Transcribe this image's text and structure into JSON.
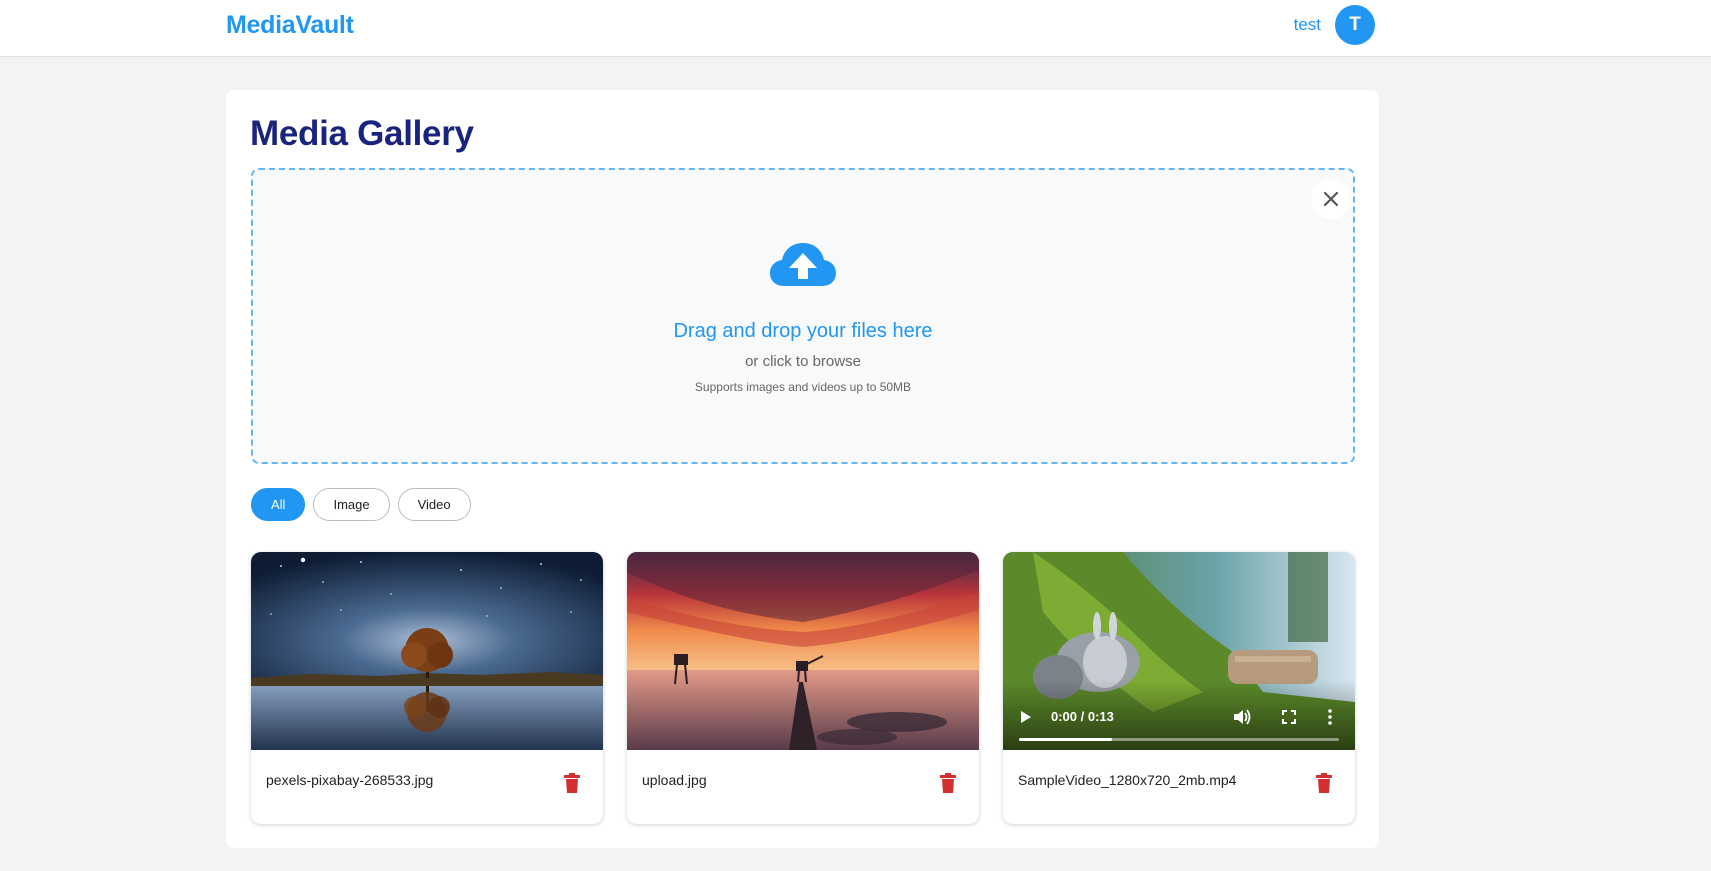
{
  "header": {
    "brand": "MediaVault",
    "username": "test",
    "avatar_initial": "T"
  },
  "main": {
    "title": "Media Gallery"
  },
  "dropzone": {
    "title": "Drag and drop your files here",
    "subtitle": "or click to browse",
    "note": "Supports images and videos up to 50MB",
    "icon": "cloud-upload-icon",
    "close_icon": "close-icon"
  },
  "filters": {
    "all": "All",
    "image": "Image",
    "video": "Video",
    "active": "All"
  },
  "media": [
    {
      "name": "pexels-pixabay-268533.jpg",
      "type": "image"
    },
    {
      "name": "upload.jpg",
      "type": "image"
    },
    {
      "name": "SampleVideo_1280x720_2mb.mp4",
      "type": "video",
      "time": "0:00 / 0:13",
      "progress": 0.29
    }
  ],
  "colors": {
    "accent": "#2196f3",
    "title": "#1a237e",
    "delete": "#d32f2f",
    "background": "#f3f3f3"
  }
}
